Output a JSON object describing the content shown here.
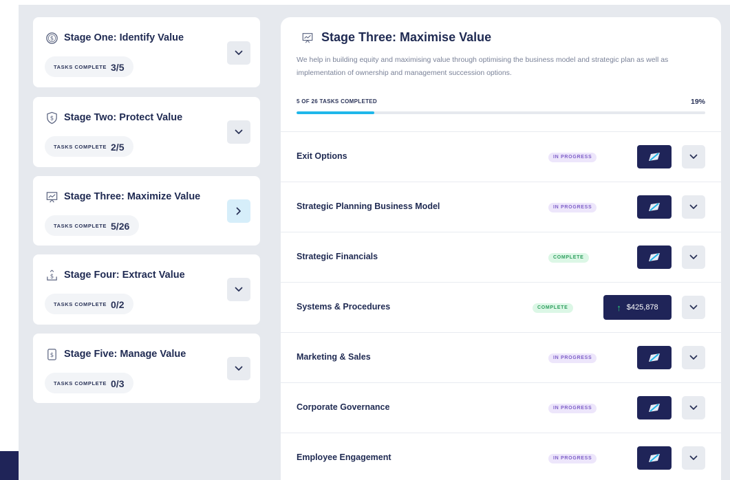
{
  "stages": [
    {
      "title": "Stage One: Identify Value",
      "tasks_label": "TASKS COMPLETE",
      "tasks_count": "3/5",
      "icon": "dollar-coin-icon",
      "button": "chevron-down"
    },
    {
      "title": "Stage Two: Protect Value",
      "tasks_label": "TASKS COMPLETE",
      "tasks_count": "2/5",
      "icon": "dollar-shield-icon",
      "button": "chevron-down"
    },
    {
      "title": "Stage Three: Maximize Value",
      "tasks_label": "TASKS COMPLETE",
      "tasks_count": "5/26",
      "icon": "presentation-chart-icon",
      "button": "chevron-right"
    },
    {
      "title": "Stage Four: Extract Value",
      "tasks_label": "TASKS COMPLETE",
      "tasks_count": "0/2",
      "icon": "dollar-upload-icon",
      "button": "chevron-down"
    },
    {
      "title": "Stage Five: Manage Value",
      "tasks_label": "TASKS COMPLETE",
      "tasks_count": "0/3",
      "icon": "dollar-document-icon",
      "button": "chevron-down"
    }
  ],
  "panel": {
    "title": "Stage Three: Maximise Value",
    "description": "We help in building equity and maximising value through optimising the business model and strategic plan as well as implementation of ownership and management succession options.",
    "progress_label": "5 OF 26 TASKS COMPLETED",
    "progress_pct": "19%",
    "progress_fraction": 0.19
  },
  "tasks": [
    {
      "name": "Exit Options",
      "status": "IN PROGRESS",
      "status_type": "progress"
    },
    {
      "name": "Strategic Planning Business Model",
      "status": "IN PROGRESS",
      "status_type": "progress"
    },
    {
      "name": "Strategic Financials",
      "status": "COMPLETE",
      "status_type": "complete"
    },
    {
      "name": "Systems & Procedures",
      "status": "COMPLETE",
      "status_type": "complete",
      "value": "$425,878"
    },
    {
      "name": "Marketing & Sales",
      "status": "IN PROGRESS",
      "status_type": "progress"
    },
    {
      "name": "Corporate Governance",
      "status": "IN PROGRESS",
      "status_type": "progress"
    },
    {
      "name": "Employee Engagement",
      "status": "IN PROGRESS",
      "status_type": "progress"
    }
  ],
  "colors": {
    "accent": "#1fb7ea",
    "navy": "#1f2458",
    "progress_badge": "#ede6fb",
    "complete_badge": "#dcf7e6"
  }
}
